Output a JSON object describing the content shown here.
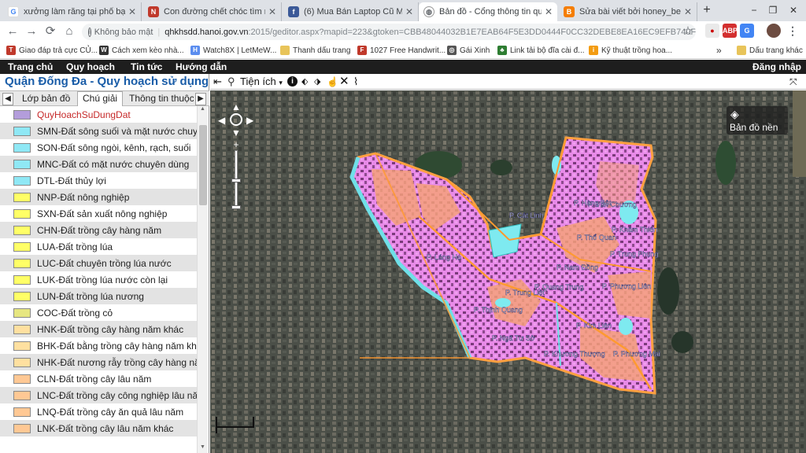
{
  "browser": {
    "tabs": [
      {
        "title": "xưởng làm răng tại phố bạch đằ",
        "favicon": "G",
        "color": "#4285f4"
      },
      {
        "title": "Con đường chết chóc tìm miền",
        "favicon": "N",
        "color": "#c0392b"
      },
      {
        "title": "(6) Mua Bán Laptop Cũ Mới Giá",
        "favicon": "f",
        "color": "#3b5998"
      },
      {
        "title": "Bản đồ - Cổng thông tin quy ho",
        "favicon": "globe",
        "color": "#5f6368"
      },
      {
        "title": "Sửa bài viết bởi honey_bee_202",
        "favicon": "B",
        "color": "#f57d00"
      }
    ],
    "new_tab": "+",
    "window_controls": [
      "−",
      "❐",
      "✕"
    ],
    "nav": {
      "back": "←",
      "forward": "→",
      "reload": "⟳",
      "home": "⌂"
    },
    "address": {
      "not_secure": "Không bảo mật",
      "host": "qhkhsdd.hanoi.gov.vn",
      "path": ":2015/geditor.aspx?mapid=223&gtoken=CBB48044032B1E7EAB64F5E3DD0444F0CC32DEBE8EA16EC9EFB740F7D1..."
    },
    "star": "☆",
    "bookmarks": [
      {
        "label": "Giao đáp trả cực CỦ...",
        "icon": "T",
        "color": "#c0392b"
      },
      {
        "label": "Cách xem kèo nhà...",
        "icon": "W",
        "color": "#333333"
      },
      {
        "label": "Watch8X | LetMeW...",
        "icon": "H",
        "color": "#5b8def"
      },
      {
        "label": "Thanh dấu trang",
        "icon": "",
        "color": "#e8c45a"
      },
      {
        "label": "1027 Free Handwrit...",
        "icon": "F",
        "color": "#c0392b"
      },
      {
        "label": "Gái Xinh",
        "icon": "◎",
        "color": "#555555"
      },
      {
        "label": "Link tải bộ đĩa cài đ...",
        "icon": "♣",
        "color": "#2e7d32"
      },
      {
        "label": "Kỹ thuật trồng hoa...",
        "icon": "i",
        "color": "#f39c12"
      }
    ],
    "bookmarks_more": "»",
    "other_bookmarks": "Dấu trang khác"
  },
  "site_menu": {
    "items": [
      "Trang chủ",
      "Quy hoạch",
      "Tin tức",
      "Hướng dẫn"
    ],
    "login": "Đăng nhập"
  },
  "panel": {
    "title": "Quận Đống Đa - Quy hoạch sử dụng đất",
    "tabs": [
      "Lớp bản đồ",
      "Chú giải",
      "Thông tin thuộc"
    ],
    "legend": [
      {
        "label": "QuyHoachSuDungDat",
        "color": "#b39ddb",
        "highlight": true
      },
      {
        "label": "SMN-Đất sông suối và mặt nước chuyên dùng",
        "color": "#8fe8f5"
      },
      {
        "label": "SON-Đất sông ngòi, kênh, rạch, suối",
        "color": "#8fe8f5"
      },
      {
        "label": "MNC-Đất có mặt nước chuyên dùng",
        "color": "#8fe8f5"
      },
      {
        "label": "DTL-Đất thủy lợi",
        "color": "#8fe8f5"
      },
      {
        "label": "NNP-Đất nông nghiệp",
        "color": "#ffff66"
      },
      {
        "label": "SXN-Đất sản xuất nông nghiệp",
        "color": "#ffff66"
      },
      {
        "label": "CHN-Đất trồng cây hàng năm",
        "color": "#ffff66"
      },
      {
        "label": "LUA-Đất trồng lúa",
        "color": "#ffff66"
      },
      {
        "label": "LUC-Đất chuyên trồng lúa nước",
        "color": "#ffff66"
      },
      {
        "label": "LUK-Đất trồng lúa nước còn lại",
        "color": "#ffff66"
      },
      {
        "label": "LUN-Đất trồng lúa nương",
        "color": "#ffff66"
      },
      {
        "label": "COC-Đất trồng cỏ",
        "color": "#e6e680"
      },
      {
        "label": "HNK-Đất trồng cây hàng năm khác",
        "color": "#ffe0a0"
      },
      {
        "label": "BHK-Đất bằng trồng cây hàng năm khác",
        "color": "#ffe0a0"
      },
      {
        "label": "NHK-Đất nương rẫy trồng cây hàng năm khác",
        "color": "#ffe0a0"
      },
      {
        "label": "CLN-Đất trồng cây lâu năm",
        "color": "#ffc894"
      },
      {
        "label": "LNC-Đất trồng cây công nghiệp lâu năm",
        "color": "#ffc894"
      },
      {
        "label": "LNQ-Đất trồng cây ăn quả lâu năm",
        "color": "#ffc894"
      },
      {
        "label": "LNK-Đất trồng cây lâu năm khác",
        "color": "#ffc894"
      }
    ]
  },
  "map_toolbar": {
    "utility": "Tiện ích",
    "icons": [
      "exit-icon",
      "pin-icon",
      "info-icon",
      "select-icon",
      "measure-icon",
      "hand-icon",
      "close-icon",
      "attach-icon"
    ]
  },
  "map": {
    "basemap_label": "Bản đồ nền",
    "wards": [
      "P. Cát Linh",
      "P. Văn Chương",
      "P. Hàng Bột",
      "P. Khâm Thiên",
      "P. Thổ Quan",
      "P. Trung Phụng",
      "P. Láng Hạ",
      "P. Nam Đồng",
      "P. Phương Liên",
      "P. Trung Liệt",
      "P. Quang Trung",
      "P. Thịnh Quang",
      "P. Kim Liên",
      "P. Ngã Tư Sở",
      "P. Khương Thượng",
      "P. Phương Mai"
    ]
  }
}
